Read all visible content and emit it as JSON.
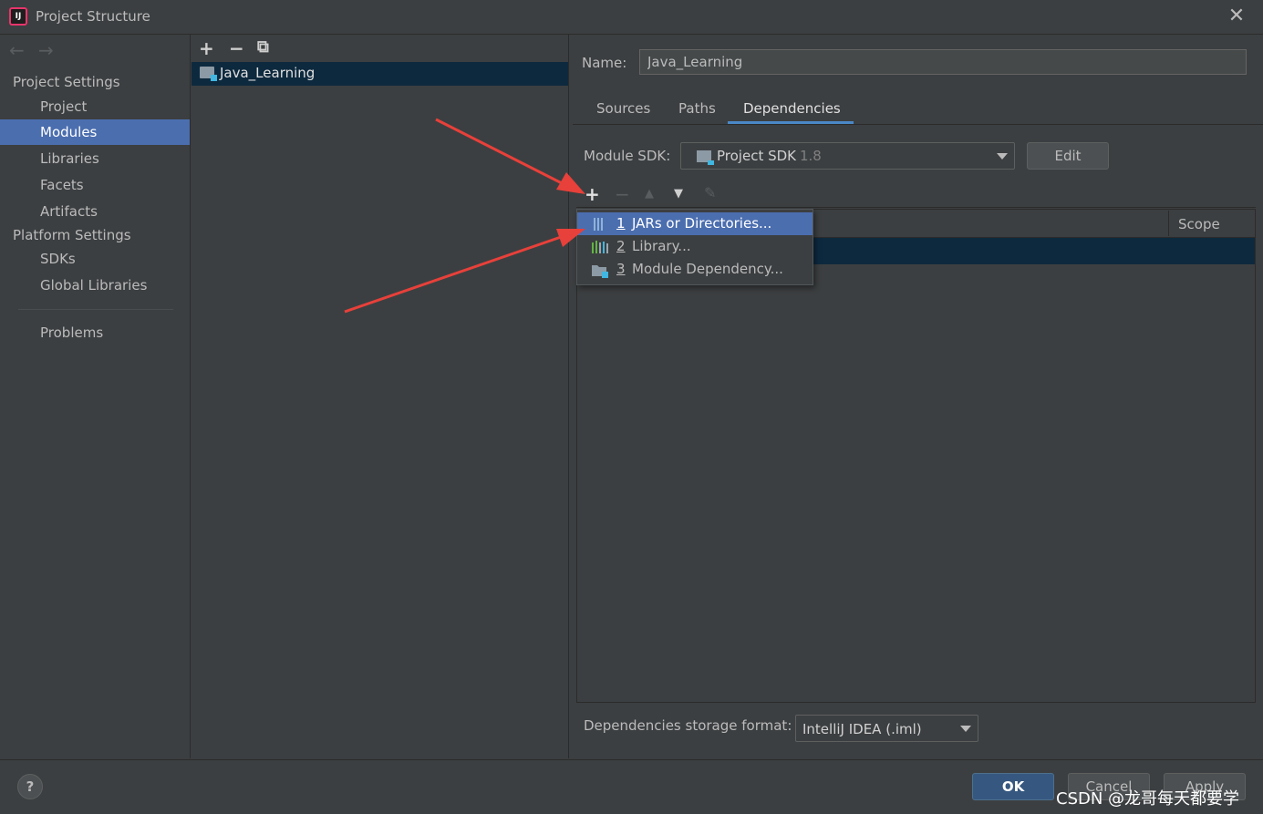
{
  "window": {
    "title": "Project Structure",
    "close_label": "✕",
    "app_icon_text": "IJ"
  },
  "nav": {
    "back_label": "←",
    "forward_label": "→",
    "project_settings_header": "Project Settings",
    "project_items": [
      "Project",
      "Modules",
      "Libraries",
      "Facets",
      "Artifacts"
    ],
    "selected_item": "Modules",
    "platform_settings_header": "Platform Settings",
    "platform_items": [
      "SDKs",
      "Global Libraries"
    ],
    "problems_label": "Problems"
  },
  "module_list": {
    "toolbar": {
      "add": "+",
      "remove": "−",
      "copy": "⧉"
    },
    "modules": [
      "Java_Learning"
    ]
  },
  "module_detail": {
    "name_label": "Name:",
    "name_value": "Java_Learning",
    "tabs": [
      "Sources",
      "Paths",
      "Dependencies"
    ],
    "active_tab": "Dependencies",
    "sdk_label": "Module SDK:",
    "sdk_value": "Project SDK",
    "sdk_version": "1.8",
    "edit_label": "Edit",
    "dep_toolbar": {
      "add": "+",
      "remove": "−",
      "up": "▲",
      "down": "▼",
      "edit": "✎"
    },
    "table_columns": {
      "scope": "Scope"
    },
    "storage_label": "Dependencies storage format:",
    "storage_value": "IntelliJ IDEA (.iml)"
  },
  "add_menu": {
    "items": [
      {
        "num": "1",
        "label": "JARs or Directories...",
        "icon": "jar-icon"
      },
      {
        "num": "2",
        "label": "Library...",
        "icon": "library-icon"
      },
      {
        "num": "3",
        "label": "Module Dependency...",
        "icon": "module-icon"
      }
    ],
    "selected_index": 0
  },
  "footer": {
    "help_label": "?",
    "ok_label": "OK",
    "cancel_label": "Cancel",
    "apply_label": "Apply",
    "watermark": "CSDN @龙哥每天都要学"
  },
  "colors": {
    "background": "#3c3f41",
    "selection": "#4b6eaf",
    "row_selection": "#0d293e",
    "ok_button": "#365880",
    "annotation_arrow": "#e8403a"
  }
}
